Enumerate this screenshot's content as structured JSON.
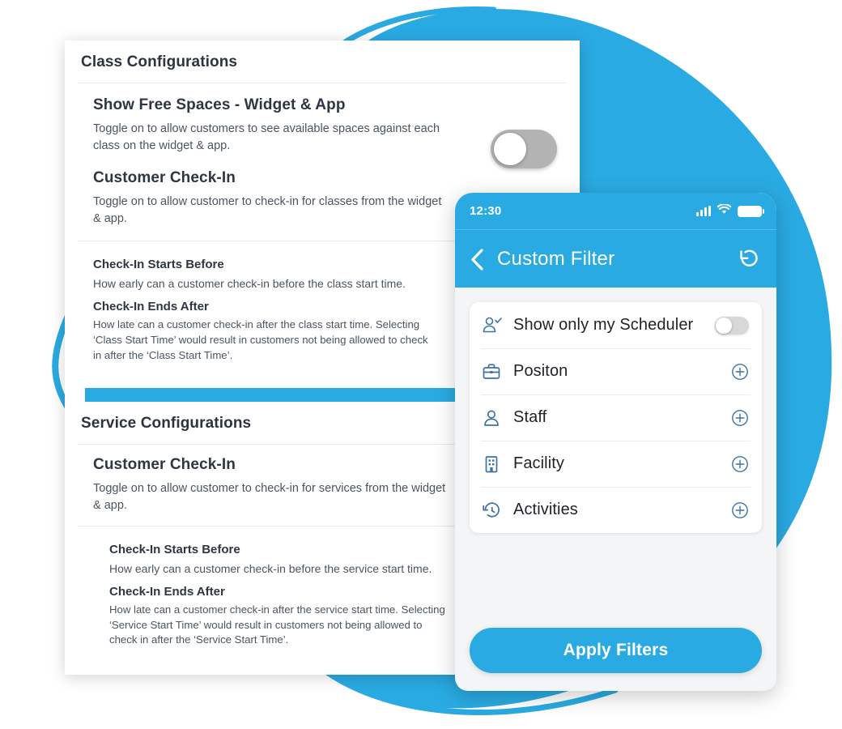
{
  "colors": {
    "accent": "#2aaae2",
    "text_dark": "#2d3642",
    "text_body": "#4a5561",
    "toggle_off": "#b3b3b3",
    "icon_blue": "#3c72a8"
  },
  "desktop": {
    "class_section": {
      "title": "Class Configurations",
      "items": [
        {
          "heading": "Show Free Spaces - Widget & App",
          "description": "Toggle on to allow customers to see available spaces against each class on the widget & app.",
          "toggle_state": "off"
        },
        {
          "heading": "Customer Check-In",
          "description": "Toggle on to allow customer to check-in for classes from the widget & app.",
          "toggle_state": "on"
        }
      ],
      "sub_items": [
        {
          "heading": "Check-In Starts Before",
          "description": "How early can a customer check-in before the class start time."
        },
        {
          "heading": "Check-In Ends After",
          "description": "How late can a customer check-in after the class start time. Selecting ‘Class Start Time’ would result in customers not being allowed to check in after the ‘Class Start Time’."
        }
      ]
    },
    "service_section": {
      "title": "Service Configurations",
      "items": [
        {
          "heading": "Customer Check-In",
          "description": "Toggle on to allow customer to check-in for services from the widget & app."
        }
      ],
      "sub_items": [
        {
          "heading": "Check-In Starts Before",
          "description": "How early can a customer check-in before the service start time."
        },
        {
          "heading": "Check-In Ends After",
          "description": "How late can a customer check-in after the service start time. Selecting ‘Service Start Time’ would result in customers not being allowed to check in after the ‘Service Start Time’."
        }
      ]
    }
  },
  "phone": {
    "status_bar": {
      "time": "12:30",
      "icons": [
        "signal-bars-icon",
        "wifi-icon",
        "battery-icon"
      ]
    },
    "nav": {
      "back_icon": "chevron-left-icon",
      "title": "Custom Filter",
      "reset_icon": "reset-rotate-icon"
    },
    "filters": [
      {
        "icon": "user-check-icon",
        "label": "Show only my Scheduler",
        "control": "toggle",
        "toggle_state": "off"
      },
      {
        "icon": "briefcase-icon",
        "label": "Positon",
        "control": "plus"
      },
      {
        "icon": "user-icon",
        "label": "Staff",
        "control": "plus"
      },
      {
        "icon": "building-icon",
        "label": "Facility",
        "control": "plus"
      },
      {
        "icon": "history-icon",
        "label": "Activities",
        "control": "plus"
      }
    ],
    "apply_button": "Apply Filters"
  }
}
